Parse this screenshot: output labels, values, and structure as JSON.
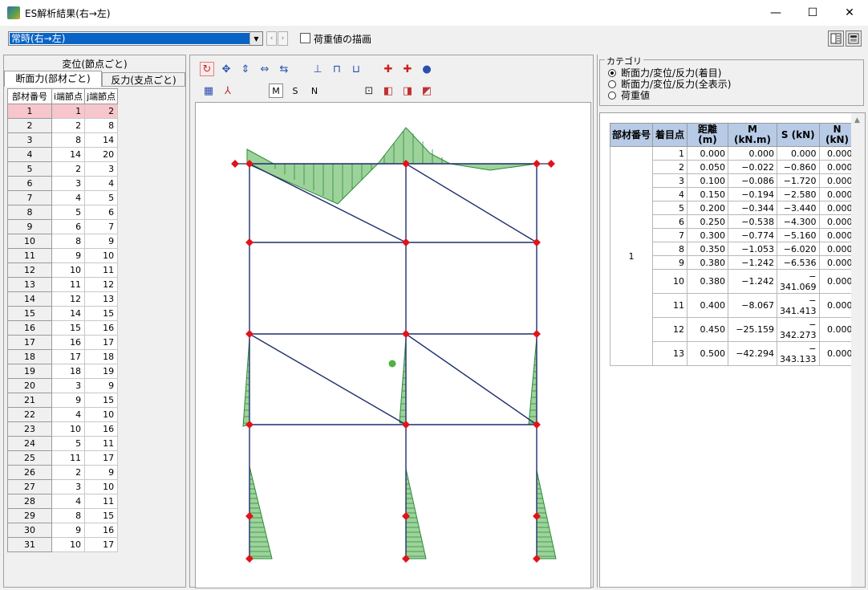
{
  "window": {
    "title": "ES解析結果(右→左)",
    "controls": [
      "—",
      "☐",
      "✕"
    ]
  },
  "toolbar": {
    "case_value": "常時(右→左)",
    "load_checkbox_label": "荷重値の描画",
    "load_checked": false
  },
  "left": {
    "tab_top": "変位(節点ごと)",
    "tab_members": "断面力(部材ごと)",
    "tab_reactions": "反力(支点ごと)",
    "headers": [
      "部材番号",
      "i端節点",
      "j端節点"
    ],
    "rows": [
      [
        "1",
        "1",
        "2"
      ],
      [
        "2",
        "2",
        "8"
      ],
      [
        "3",
        "8",
        "14"
      ],
      [
        "4",
        "14",
        "20"
      ],
      [
        "5",
        "2",
        "3"
      ],
      [
        "6",
        "3",
        "4"
      ],
      [
        "7",
        "4",
        "5"
      ],
      [
        "8",
        "5",
        "6"
      ],
      [
        "9",
        "6",
        "7"
      ],
      [
        "10",
        "8",
        "9"
      ],
      [
        "11",
        "9",
        "10"
      ],
      [
        "12",
        "10",
        "11"
      ],
      [
        "13",
        "11",
        "12"
      ],
      [
        "14",
        "12",
        "13"
      ],
      [
        "15",
        "14",
        "15"
      ],
      [
        "16",
        "15",
        "16"
      ],
      [
        "17",
        "16",
        "17"
      ],
      [
        "18",
        "17",
        "18"
      ],
      [
        "19",
        "18",
        "19"
      ],
      [
        "20",
        "3",
        "9"
      ],
      [
        "21",
        "9",
        "15"
      ],
      [
        "22",
        "4",
        "10"
      ],
      [
        "23",
        "10",
        "16"
      ],
      [
        "24",
        "5",
        "11"
      ],
      [
        "25",
        "11",
        "17"
      ],
      [
        "26",
        "2",
        "9"
      ],
      [
        "27",
        "3",
        "10"
      ],
      [
        "28",
        "4",
        "11"
      ],
      [
        "29",
        "8",
        "15"
      ],
      [
        "30",
        "9",
        "16"
      ],
      [
        "31",
        "10",
        "17"
      ]
    ],
    "selected_row": 0
  },
  "middle": {
    "toolbar_row1_icons": [
      "rotate-x-icon",
      "rotate-y-icon",
      "move-vertical-icon",
      "move-horizontal-icon",
      "pan-icon",
      "support-1-icon",
      "support-2-icon",
      "support-3-icon",
      "zoom-in-icon",
      "zoom-out-icon",
      "dot-icon"
    ],
    "toolbar_row2_icons": [
      "grid-icon",
      "axis-icon"
    ],
    "mode_buttons": [
      "M",
      "S",
      "N"
    ],
    "mode_selected": "M",
    "view_icons": [
      "fit-icon",
      "cube-front-icon",
      "cube-side-icon",
      "cube-iso-icon"
    ]
  },
  "right": {
    "category_title": "カテゴリ",
    "options": [
      "断面力/変位/反力(着目)",
      "断面力/変位/反力(全表示)",
      "荷重値"
    ],
    "selected_option": 0,
    "headers": [
      "部材番号",
      "着目点",
      "距離\n(m)",
      "M\n(kN.m)",
      "S (kN)",
      "N\n(kN)"
    ],
    "member": "1",
    "rows": [
      [
        "1",
        "0.000",
        "0.000",
        "0.000",
        "0.000"
      ],
      [
        "2",
        "0.050",
        "−0.022",
        "−0.860",
        "0.000"
      ],
      [
        "3",
        "0.100",
        "−0.086",
        "−1.720",
        "0.000"
      ],
      [
        "4",
        "0.150",
        "−0.194",
        "−2.580",
        "0.000"
      ],
      [
        "5",
        "0.200",
        "−0.344",
        "−3.440",
        "0.000"
      ],
      [
        "6",
        "0.250",
        "−0.538",
        "−4.300",
        "0.000"
      ],
      [
        "7",
        "0.300",
        "−0.774",
        "−5.160",
        "0.000"
      ],
      [
        "8",
        "0.350",
        "−1.053",
        "−6.020",
        "0.000"
      ],
      [
        "9",
        "0.380",
        "−1.242",
        "−6.536",
        "0.000"
      ],
      [
        "10",
        "0.380",
        "−1.242",
        "−\n341.069",
        "0.000"
      ],
      [
        "11",
        "0.400",
        "−8.067",
        "−\n341.413",
        "0.000"
      ],
      [
        "12",
        "0.450",
        "−25.159",
        "−\n342.273",
        "0.000"
      ],
      [
        "13",
        "0.500",
        "−42.294",
        "−\n343.133",
        "0.000"
      ]
    ]
  },
  "colors": {
    "selection": "#0a64c6",
    "selected_row": "#f7c6cc",
    "table_header": "#b8cbe6",
    "frame_line": "#1f2d6e",
    "diagram_fill": "#7cc47a",
    "diagram_line": "#2e8b3a",
    "node": "#e0141a"
  }
}
